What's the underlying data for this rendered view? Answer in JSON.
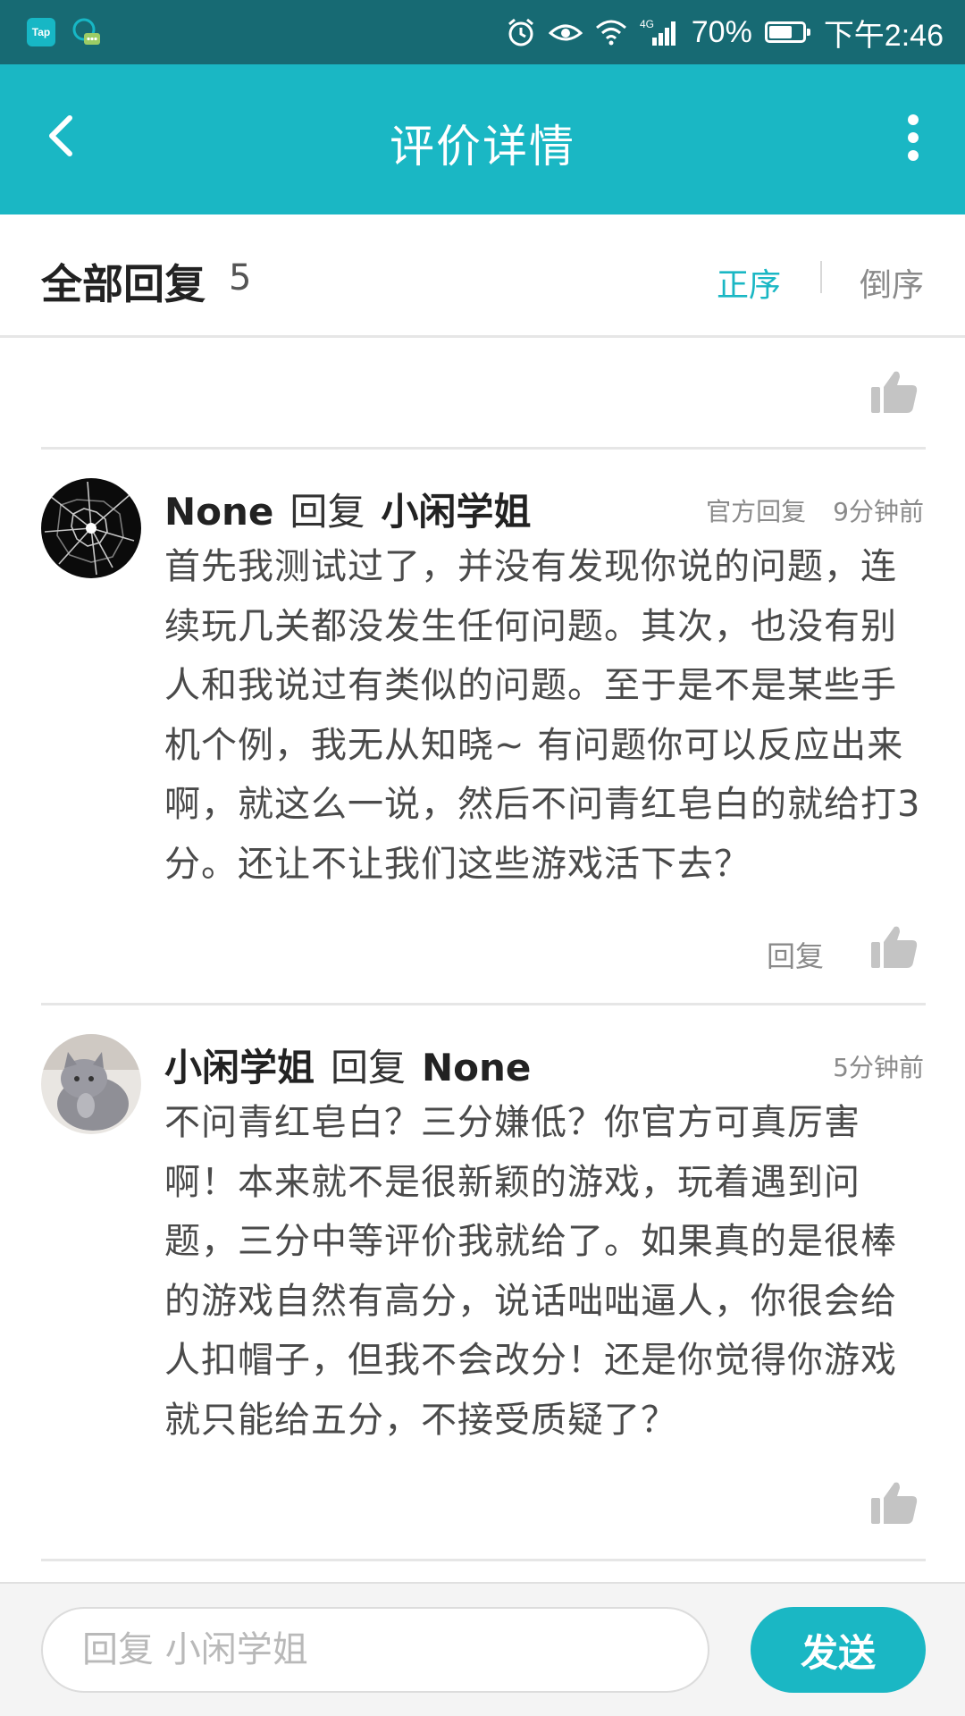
{
  "status_bar": {
    "tap_label": "Tap",
    "network": "4G",
    "battery": "70%",
    "battery_level": 0.7,
    "time": "下午2:46"
  },
  "app_bar": {
    "title": "评价详情",
    "back_icon": "chevron-left-icon",
    "more_icon": "more-vertical-icon"
  },
  "replies_header": {
    "title": "全部回复",
    "count": "5",
    "sort_asc": "正序",
    "sort_desc": "倒序"
  },
  "comments": [
    {
      "author": "None",
      "reply_word": "回复",
      "target": "小闲学姐",
      "badge": "官方回复",
      "time": "9分钟前",
      "body": "首先我测试过了，并没有发现你说的问题，连续玩几关都没发生任何问题。其次，也没有别人和我说过有类似的问题。至于是不是某些手机个例，我无从知晓~ 有问题你可以反应出来啊，就这么一说，然后不问青红皂白的就给打3分。还让不让我们这些游戏活下去？",
      "reply_label": "回复"
    },
    {
      "author": "小闲学姐",
      "reply_word": "回复",
      "target": "None",
      "time": "5分钟前",
      "body": "不问青红皂白？三分嫌低？你官方可真厉害啊！本来就不是很新颖的游戏，玩着遇到问题，三分中等评价我就给了。如果真的是很棒的游戏自然有高分，说话咄咄逼人，你很会给人扣帽子，但我不会改分！还是你觉得你游戏就只能给五分，不接受质疑了？"
    }
  ],
  "bottom_bar": {
    "placeholder": "回复 小闲学姐",
    "send_label": "发送"
  },
  "colors": {
    "status_bar": "#176a73",
    "accent": "#1ab7c4",
    "text_dark": "#222222",
    "text_muted": "#8a8a8a"
  }
}
